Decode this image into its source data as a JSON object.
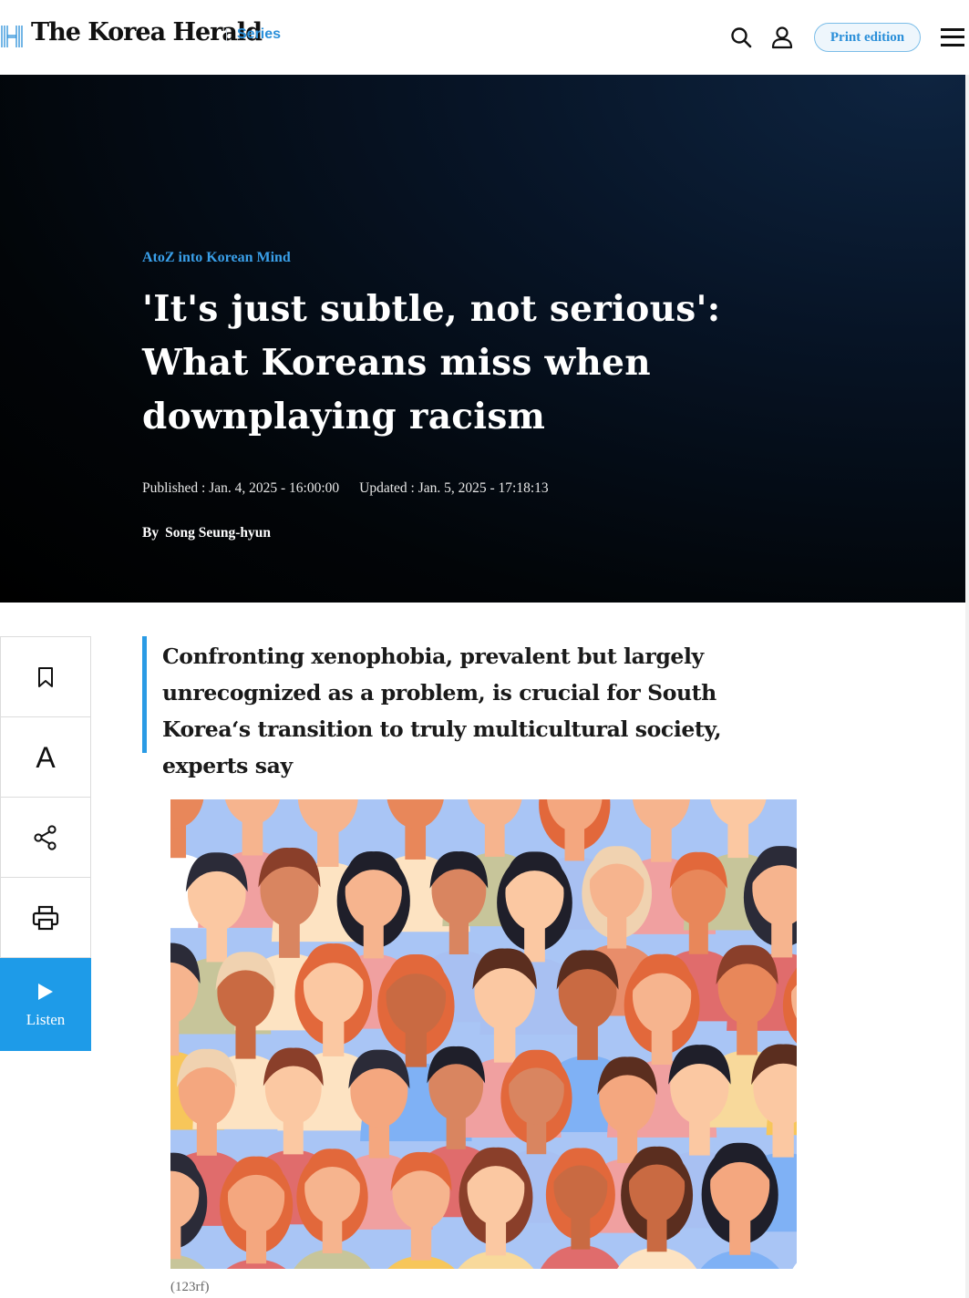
{
  "header": {
    "logo_text": "The Korea Herald",
    "series_label": "Series",
    "print_edition_label": "Print edition",
    "icons": [
      "search-icon",
      "user-icon",
      "menu-icon"
    ]
  },
  "article": {
    "kicker": "AtoZ into Korean Mind",
    "headline": "'It's just subtle, not serious': What Koreans miss when downplaying racism",
    "published": "Published : Jan. 4, 2025 - 16:00:00",
    "updated": "Updated : Jan. 5, 2025 - 17:18:13",
    "by": "By",
    "author": "Song Seung-hyun",
    "summary": "Confronting xenophobia, prevalent but largely unrecognized as a problem, is crucial for South Korea‘s transition to truly multicultural society, experts say",
    "image_caption": "(123rf)"
  },
  "tools": {
    "items": [
      "bookmark-icon",
      "font-size-icon",
      "share-icon",
      "print-icon"
    ],
    "font_label": "A",
    "listen_label": "Listen"
  },
  "colors": {
    "accent": "#2a9be5",
    "kicker": "#3aa0ea",
    "hero_bg": "#020508",
    "listen_bg": "#1e9be8"
  }
}
